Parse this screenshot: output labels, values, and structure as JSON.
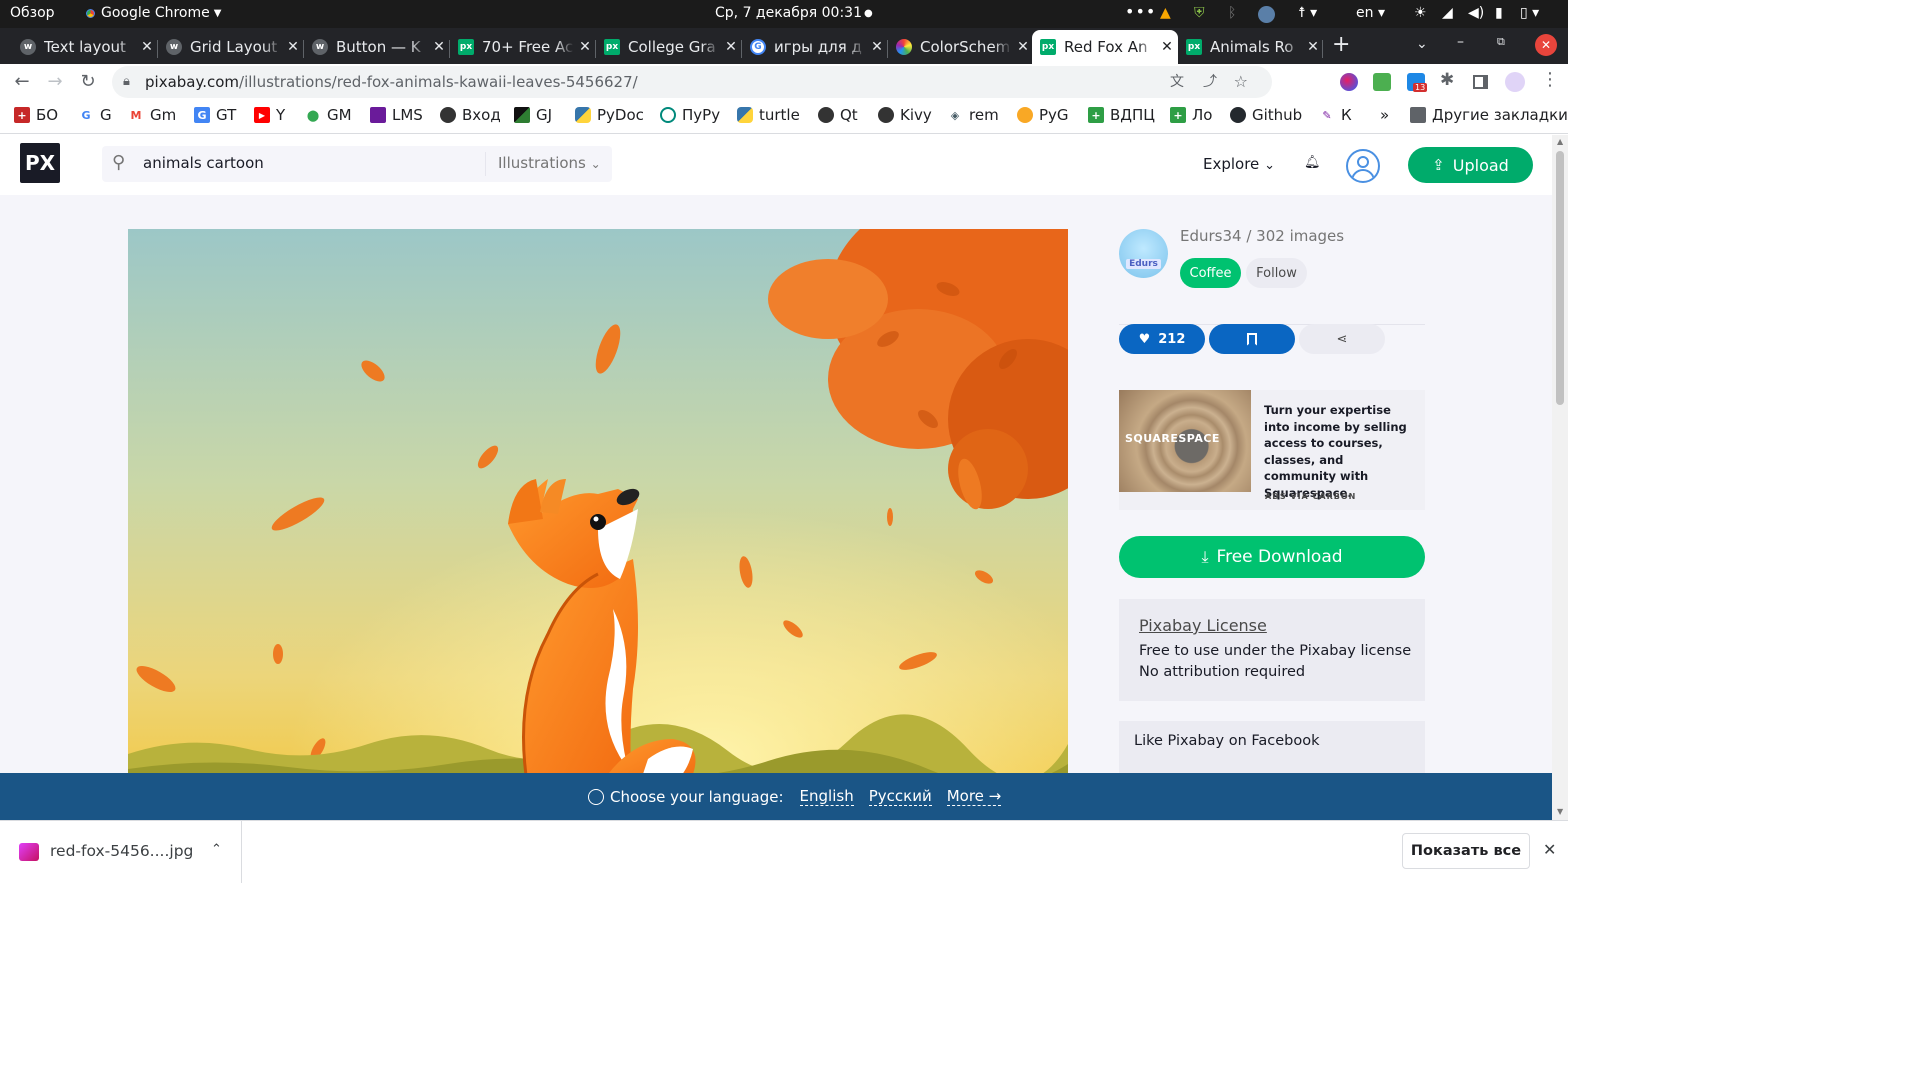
{
  "topbar": {
    "overview": "Обзор",
    "app": "Google Chrome",
    "datetime": "Ср, 7 декабря  00:31",
    "lang": "en"
  },
  "tabs": [
    {
      "label": "Text layout",
      "fav": "#5f6368"
    },
    {
      "label": "Grid Layout",
      "fav": "#5f6368"
    },
    {
      "label": "Button — K",
      "fav": "#5f6368"
    },
    {
      "label": "70+ Free Ac",
      "fav": "#00ab6b"
    },
    {
      "label": "College Gra",
      "fav": "#00ab6b"
    },
    {
      "label": "игры для д",
      "fav": "#4285f4"
    },
    {
      "label": "ColorSchem",
      "fav": "#e91e63"
    },
    {
      "label": "Red Fox An",
      "fav": "#00ab6b"
    },
    {
      "label": "Animals Ro",
      "fav": "#00ab6b"
    }
  ],
  "address": {
    "domain": "pixabay.com",
    "path": "/illustrations/red-fox-animals-kawaii-leaves-5456627/"
  },
  "bookmarks": [
    {
      "label": "БО",
      "color": "#c62828"
    },
    {
      "label": "G",
      "color": "#4285f4"
    },
    {
      "label": "Gm",
      "color": "#ea4335"
    },
    {
      "label": "GT",
      "color": "#4285f4"
    },
    {
      "label": "Y",
      "color": "#ff0000"
    },
    {
      "label": "GM",
      "color": "#34a853"
    },
    {
      "label": "LMS",
      "color": "#6a1b9a"
    },
    {
      "label": "Вход",
      "color": "#333333"
    },
    {
      "label": "GJ",
      "color": "#2e7d32"
    },
    {
      "label": "PyDoc",
      "color": "#3776ab"
    },
    {
      "label": "ПуРу",
      "color": "#00897b"
    },
    {
      "label": "turtle",
      "color": "#3776ab"
    },
    {
      "label": "Qt",
      "color": "#333333"
    },
    {
      "label": "Kivy",
      "color": "#333333"
    },
    {
      "label": "rem",
      "color": "#455a64"
    },
    {
      "label": "PyG",
      "color": "#f9a825"
    },
    {
      "label": "ВДПЦ",
      "color": "#2e9e45"
    },
    {
      "label": "Ло",
      "color": "#2e9e45"
    },
    {
      "label": "Github",
      "color": "#24292e"
    },
    {
      "label": "К",
      "color": "#7b1fa2"
    }
  ],
  "bookmarks_more": "»",
  "other_bookmarks": "Другие закладки",
  "site": {
    "logo": "PX",
    "search_query": "animals cartoon",
    "search_category": "Illustrations",
    "explore": "Explore",
    "upload": "Upload"
  },
  "author": {
    "avatar_text": "Edurs",
    "name_line": "Edurs34 / 302 images",
    "coffee": "Coffee",
    "follow": "Follow"
  },
  "actions": {
    "likes": "212"
  },
  "ad": {
    "brand": "SQUARESPACE",
    "text": "Turn your expertise into income by selling access to courses, classes, and community with Squarespace.",
    "via": "ADS VIA CARBON"
  },
  "download_label": "Free Download",
  "license": {
    "title": "Pixabay License",
    "line1": "Free to use under the Pixabay license",
    "line2": "No attribution required"
  },
  "facebook": "Like Pixabay on Facebook",
  "language": {
    "prompt": "Choose your language:",
    "english": "English",
    "russian": "Русский",
    "more": "More →"
  },
  "downloads_bar": {
    "file": "red-fox-5456....jpg",
    "show_all": "Показать все"
  },
  "colors": {
    "brand_green": "#00ab6b",
    "like_blue": "#0a66c2",
    "lang_bar": "#1a5586"
  }
}
